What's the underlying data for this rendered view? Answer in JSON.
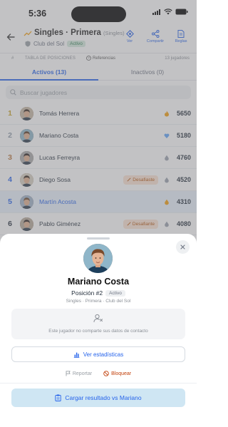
{
  "status": {
    "time": "5:36"
  },
  "header": {
    "title": "Singles · Primera",
    "title_suffix": "(Singles)",
    "club": "Club del Sol",
    "status_chip": "Activo",
    "actions": [
      {
        "label": "Ver",
        "icon": "target-icon"
      },
      {
        "label": "Compartir",
        "icon": "share-icon"
      },
      {
        "label": "Reglas",
        "icon": "document-icon"
      }
    ]
  },
  "table_header": {
    "hash": "#",
    "title": "TABLA DE POSICIONES",
    "references": "Referencias",
    "count": "13 jugadores"
  },
  "tabs": [
    {
      "label": "Activos (13)",
      "active": true
    },
    {
      "label": "Inactivos (0)",
      "active": false
    }
  ],
  "search": {
    "placeholder": "Buscar jugadores"
  },
  "rows": [
    {
      "rank": "1",
      "name": "Tomás Herrera",
      "points": "5650",
      "rank_color": "gold",
      "trend": "fire",
      "trend_color": "#f59e0b",
      "challenge": ""
    },
    {
      "rank": "2",
      "name": "Mariano Costa",
      "points": "5180",
      "rank_color": "silver",
      "trend": "heart",
      "trend_color": "#60a5fa",
      "challenge": ""
    },
    {
      "rank": "3",
      "name": "Lucas Ferreyra",
      "points": "4760",
      "rank_color": "bronze",
      "trend": "drop",
      "trend_color": "#9ca3af",
      "challenge": ""
    },
    {
      "rank": "4",
      "name": "Diego Sosa",
      "points": "4520",
      "rank_color": "blue",
      "trend": "drop",
      "trend_color": "#9ca3af",
      "challenge": "Desafiaste"
    },
    {
      "rank": "5",
      "name": "Martín Acosta",
      "points": "4310",
      "rank_color": "blue",
      "trend": "drop",
      "trend_color": "#f59e0b",
      "challenge": "",
      "highlight": true
    },
    {
      "rank": "6",
      "name": "Pablo Giménez",
      "points": "4080",
      "rank_color": "default",
      "trend": "drop",
      "trend_color": "#9ca3af",
      "challenge": "Desafiante"
    }
  ],
  "sheet": {
    "name": "Mariano Costa",
    "position": "Posición #2",
    "position_chip": "Activo",
    "context": "Singles · Primera · Club del Sol",
    "contact_notice": "Este jugador no comparte sus datos de contacto",
    "stats_button": "Ver estadísticas",
    "report": "Reportar",
    "block": "Bloquear",
    "primary_button": "Cargar resultado vs Mariano"
  }
}
